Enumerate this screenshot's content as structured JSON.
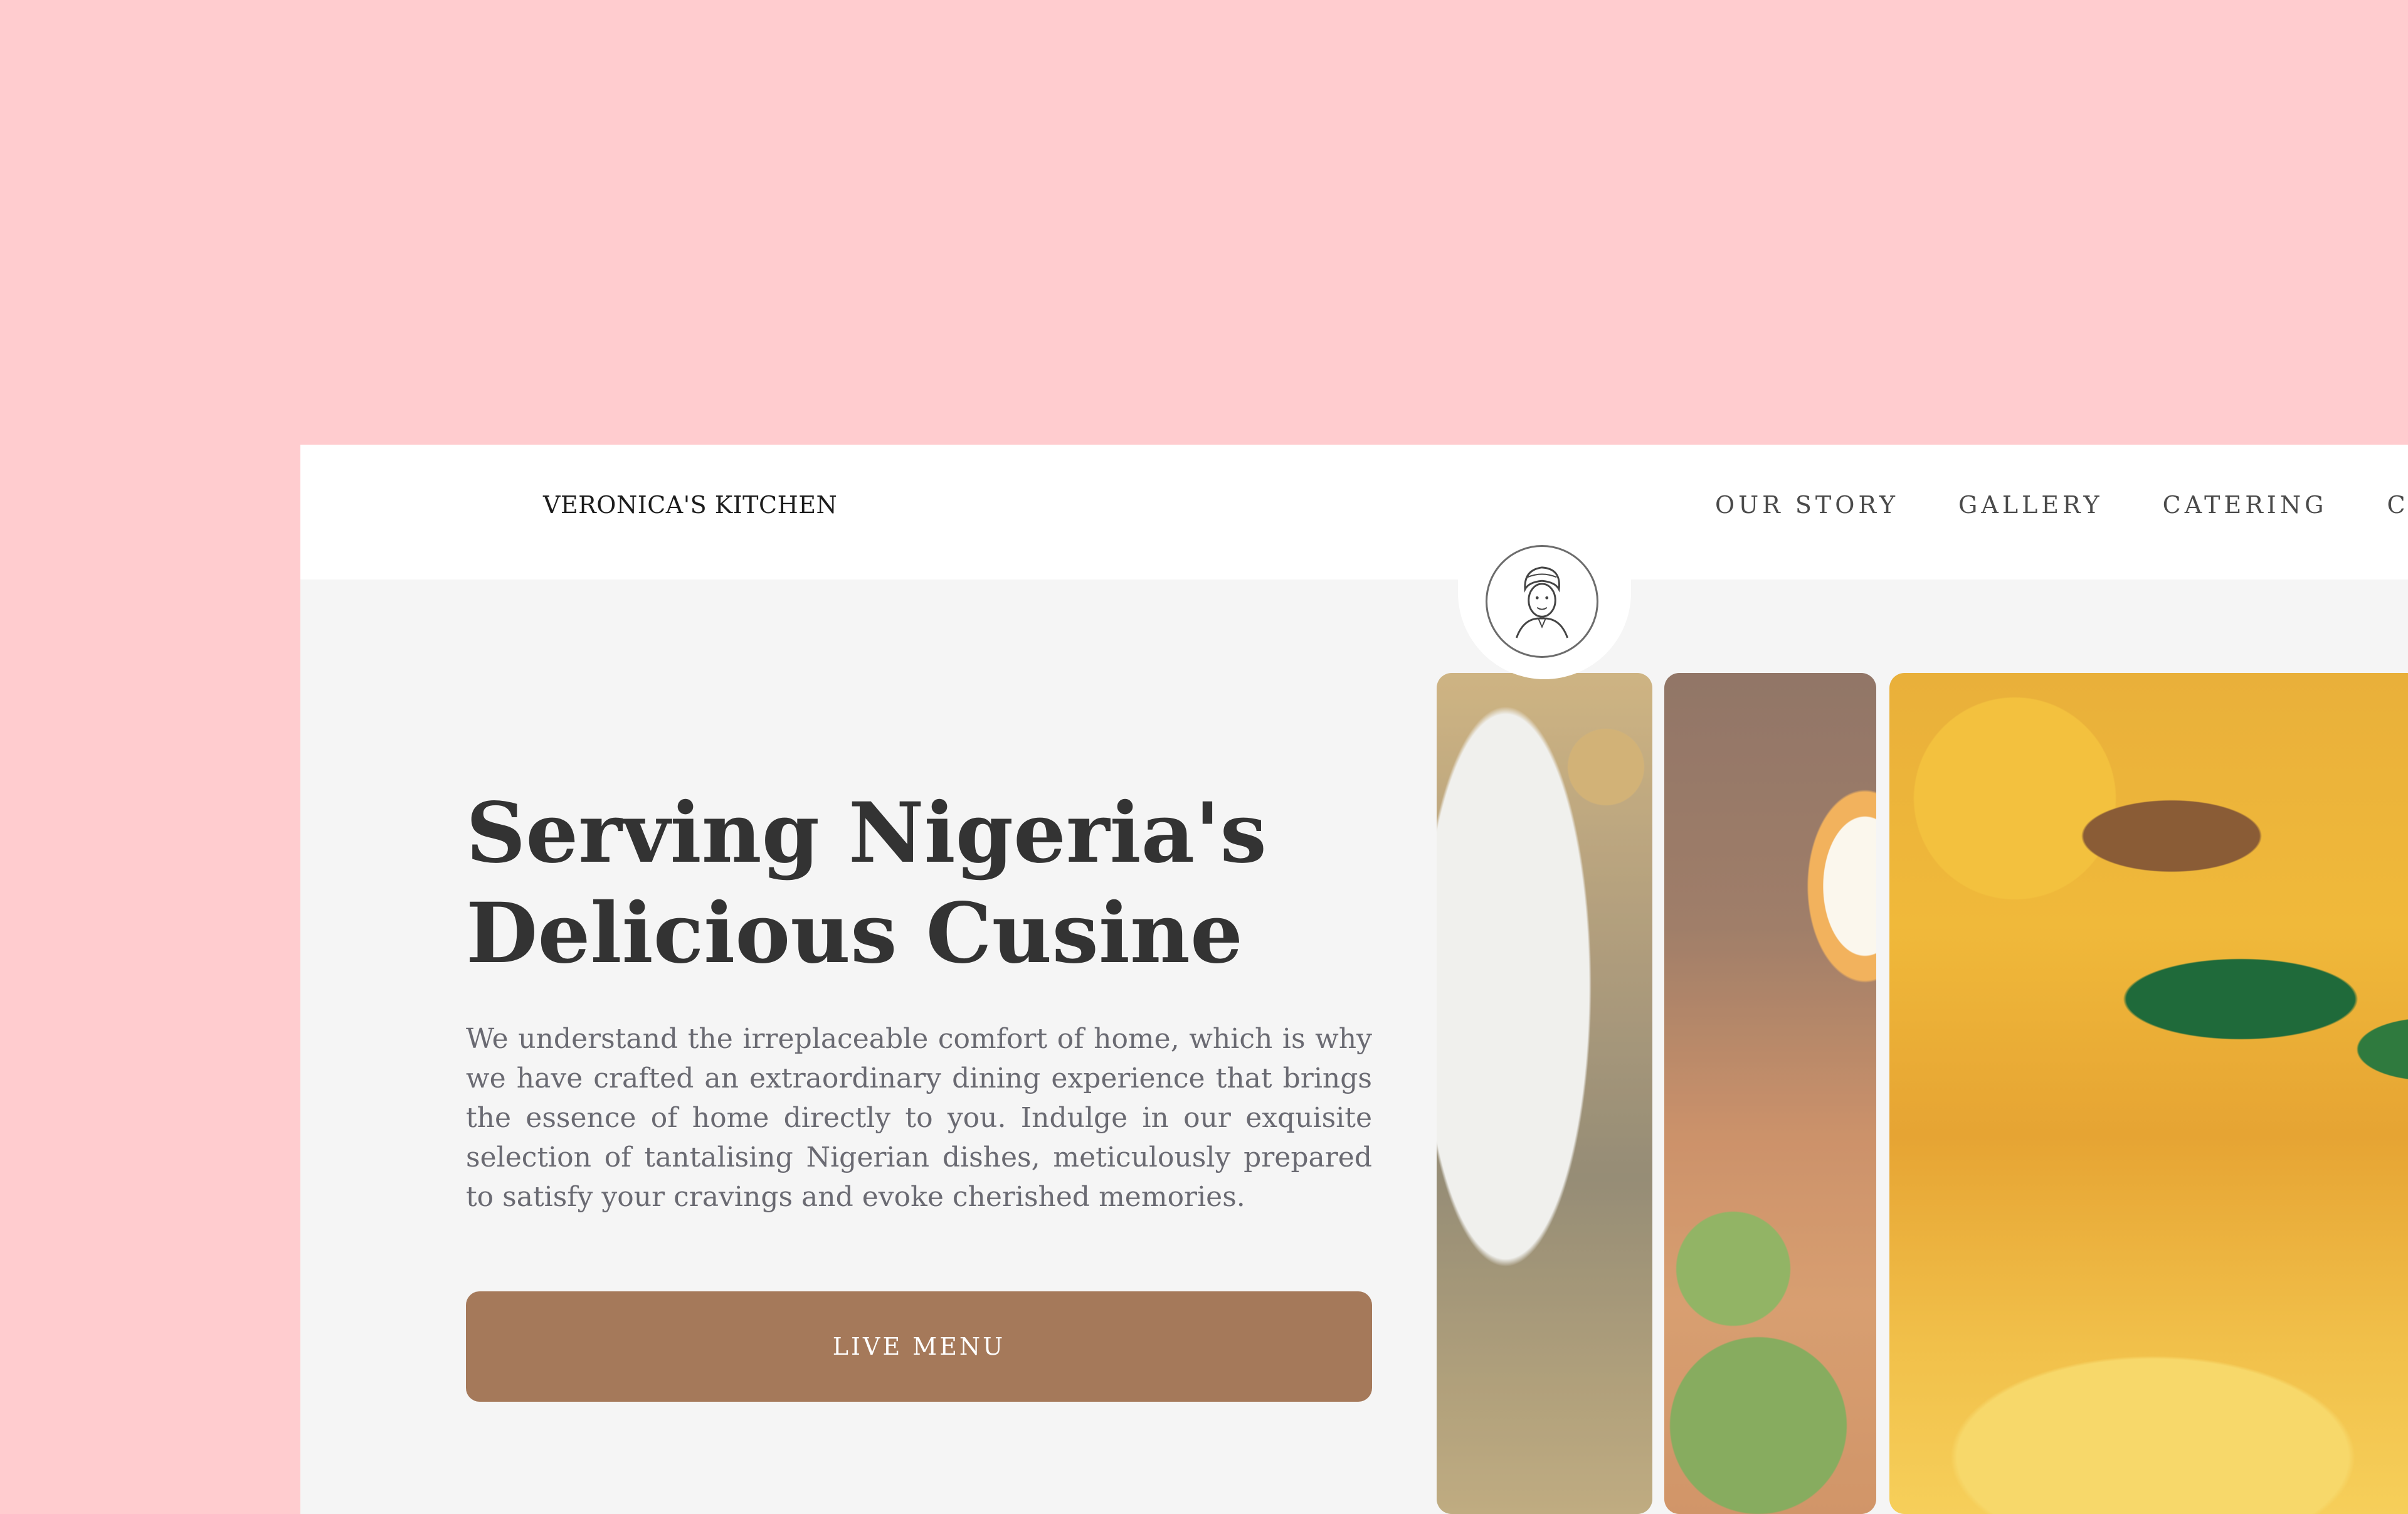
{
  "header": {
    "brand": "VERONICA'S KITCHEN",
    "nav": [
      "OUR STORY",
      "GALLERY",
      "CATERING",
      "CON"
    ]
  },
  "logo": {
    "icon": "chef-portrait-icon"
  },
  "hero": {
    "title_line1": "Serving Nigeria's",
    "title_line2": "Delicious Cusine",
    "description": "We understand the irreplaceable comfort of home, which is why we have crafted an extraordinary dining experience that brings the essence of home directly to you. Indulge in our exquisite selection of tantalising Nigerian dishes, meticulously prepared to satisfy your cravings and evoke cherished memories.",
    "cta_label": "LIVE MENU"
  },
  "colors": {
    "page_background": "#ffcccf",
    "hero_background": "#f5f5f5",
    "cta_button": "#a5795a",
    "heading": "#333333"
  }
}
